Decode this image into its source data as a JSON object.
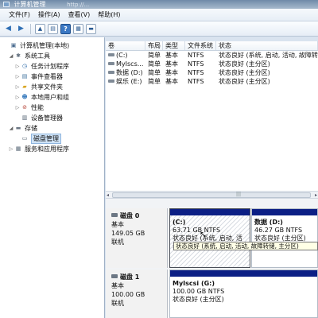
{
  "window": {
    "title": "计算机管理",
    "faint_title": "http://..."
  },
  "menu": [
    "文件(F)",
    "操作(A)",
    "查看(V)",
    "帮助(H)"
  ],
  "tree": {
    "items": [
      {
        "label": "计算机管理(本地)",
        "level": 0,
        "expander": "",
        "icon": "computer-icon"
      },
      {
        "label": "系统工具",
        "level": 1,
        "expander": "◢",
        "icon": "tools-icon"
      },
      {
        "label": "任务计划程序",
        "level": 2,
        "expander": "▷",
        "icon": "clock-icon"
      },
      {
        "label": "事件查看器",
        "level": 2,
        "expander": "▷",
        "icon": "event-viewer-icon"
      },
      {
        "label": "共享文件夹",
        "level": 2,
        "expander": "▷",
        "icon": "shared-folder-icon"
      },
      {
        "label": "本地用户和组",
        "level": 2,
        "expander": "▷",
        "icon": "users-icon"
      },
      {
        "label": "性能",
        "level": 2,
        "expander": "▷",
        "icon": "performance-icon"
      },
      {
        "label": "设备管理器",
        "level": 2,
        "expander": "",
        "icon": "device-manager-icon"
      },
      {
        "label": "存储",
        "level": 1,
        "expander": "◢",
        "icon": "storage-icon"
      },
      {
        "label": "磁盘管理",
        "level": 2,
        "expander": "",
        "icon": "disk-management-icon",
        "selected": true
      },
      {
        "label": "服务和应用程序",
        "level": 1,
        "expander": "▷",
        "icon": "services-icon"
      }
    ]
  },
  "volumes": {
    "headers": [
      "卷",
      "布局",
      "类型",
      "文件系统",
      "状态"
    ],
    "rows": [
      [
        "(C:)",
        "简单",
        "基本",
        "NTFS",
        "状态良好 (系统, 启动, 活动, 故障转"
      ],
      [
        "MyIscs...",
        "简单",
        "基本",
        "NTFS",
        "状态良好 (主分区)"
      ],
      [
        "数据 (D:)",
        "简单",
        "基本",
        "NTFS",
        "状态良好 (主分区)"
      ],
      [
        "娱乐 (E:)",
        "简单",
        "基本",
        "NTFS",
        "状态良好 (主分区)"
      ]
    ]
  },
  "disks": [
    {
      "name": "磁盘 0",
      "type": "基本",
      "size": "149.05 GB",
      "status": "联机",
      "partitions": [
        {
          "title": "(C:)",
          "size": "63.71 GB NTFS",
          "status": "状态良好 (系统, 启动, 活动, 故障转储, 主分区)"
        },
        {
          "title": "数据  (D:)",
          "size": "46.27 GB NTFS",
          "status": "状态良好 (主分区)"
        }
      ]
    },
    {
      "name": "磁盘 1",
      "type": "基本",
      "size": "100.00 GB",
      "status": "联机",
      "partitions": [
        {
          "title": "MyIscsi   (G:)",
          "size": "100.00 GB NTFS",
          "status": "状态良好 (主分区)"
        }
      ]
    }
  ],
  "tooltip": "状态良好 (系统, 启动, 活动, 故障转储, 主分区)",
  "colors": {
    "partition_bar": "#0c1f85",
    "selection": "#cfe3f7"
  }
}
